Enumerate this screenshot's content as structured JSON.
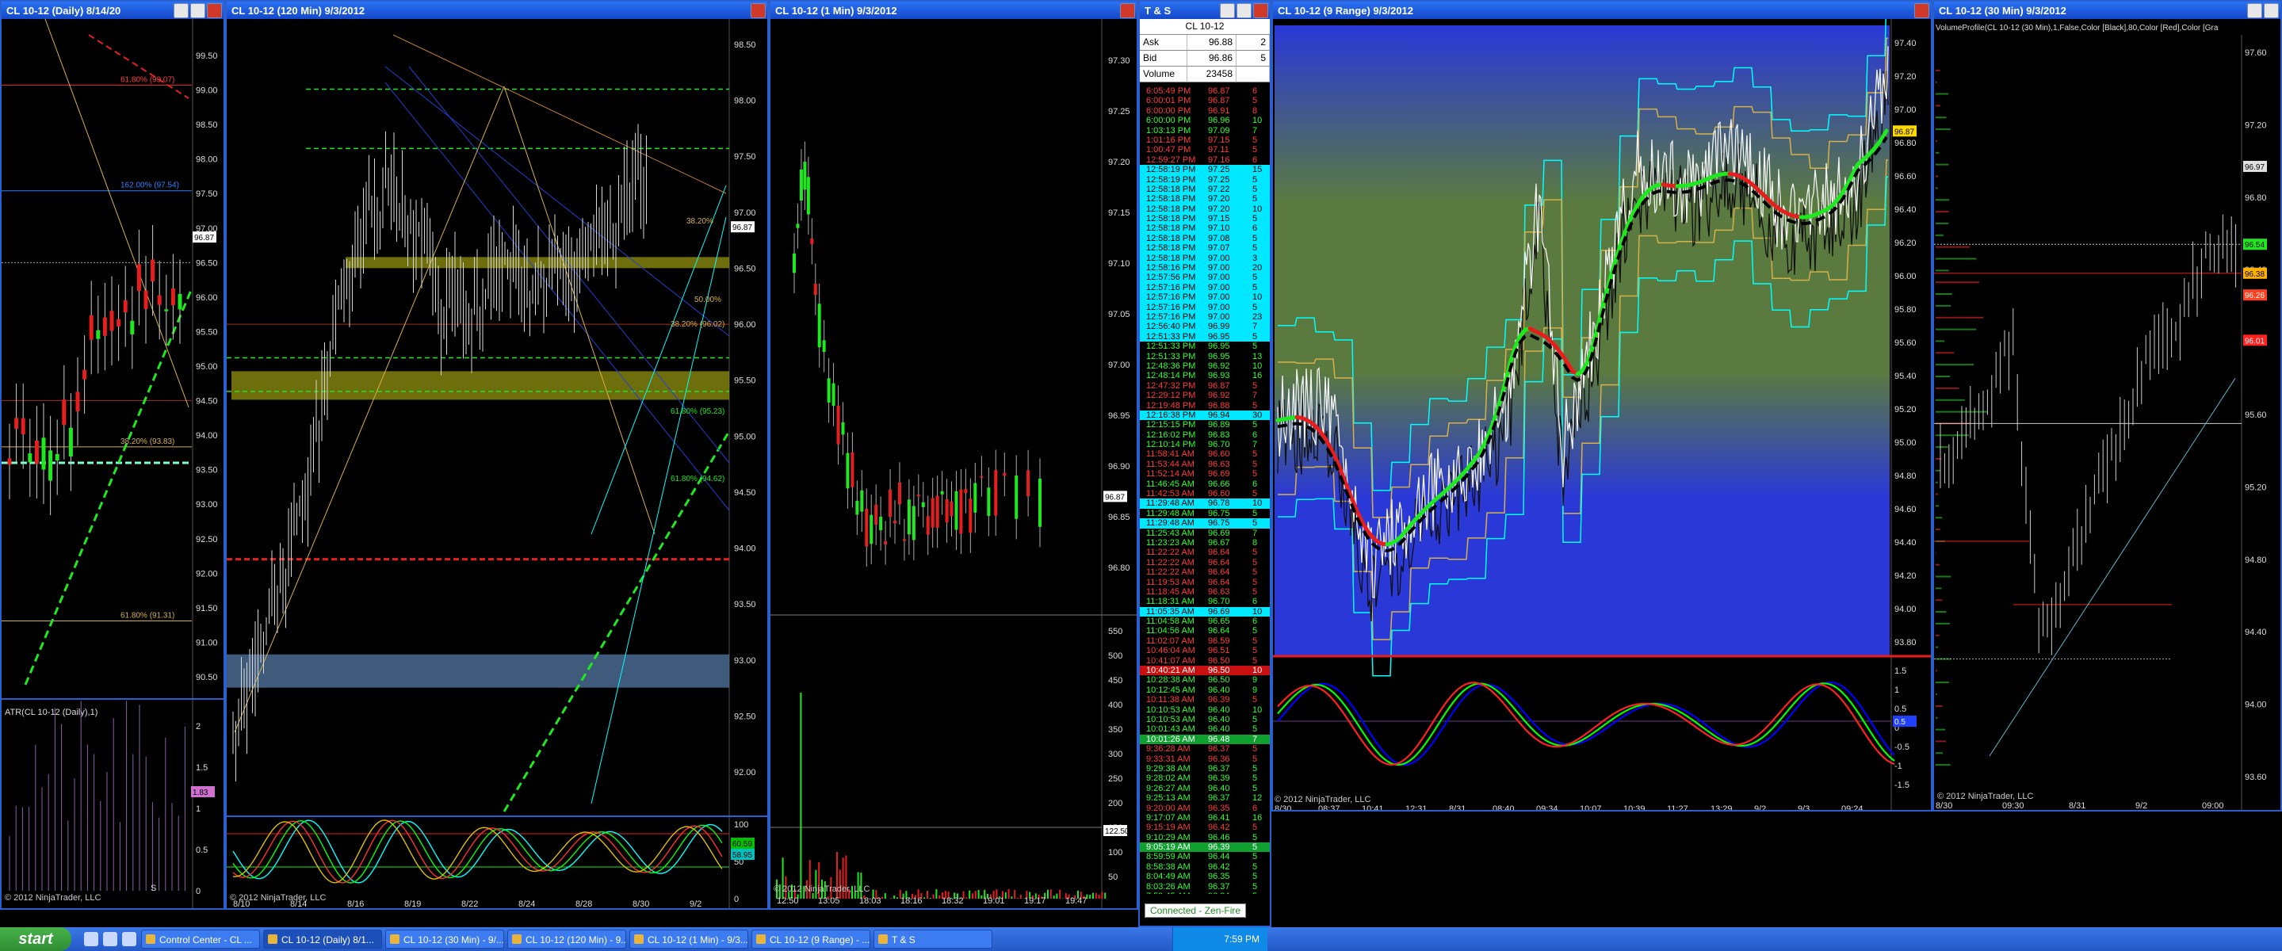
{
  "windows": {
    "daily": {
      "title": "CL 10-12 (Daily)  8/14/20",
      "price_tag": "96.87",
      "axis": [
        "99.50",
        "99.00",
        "98.50",
        "98.00",
        "97.50",
        "97.00",
        "96.50",
        "96.00",
        "95.50",
        "95.00",
        "94.50",
        "94.00",
        "93.50",
        "93.00",
        "92.50",
        "92.00",
        "91.50",
        "91.00",
        "90.50"
      ],
      "fib_labels": [
        "61.80% (99.07)",
        "162.00% (97.54)",
        "38.20% (93.83)",
        "61.80% (91.31)"
      ],
      "indicator_label": "ATR(CL 10-12 (Daily),1)",
      "ind_axis": [
        "2",
        "1.5",
        "1",
        "0.5",
        "0"
      ],
      "ind_tag": "1.83",
      "xaxis": [
        "S"
      ],
      "copyright": "© 2012 NinjaTrader, LLC"
    },
    "min120": {
      "title": "CL 10-12 (120 Min)  9/3/2012",
      "price_tag": "96.87",
      "axis": [
        "98.50",
        "98.00",
        "97.50",
        "97.00",
        "96.50",
        "96.00",
        "95.50",
        "95.00",
        "94.50",
        "94.00",
        "93.50",
        "93.00",
        "92.50",
        "92.00"
      ],
      "fib_labels": [
        "38.20%",
        "50.00%",
        "38.20% (96.02)",
        "61.80% (95.23)",
        "61.80% (94.62)"
      ],
      "xaxis": [
        "8/10",
        "8/14",
        "8/16",
        "8/19",
        "8/22",
        "8/24",
        "8/28",
        "8/30",
        "9/2"
      ],
      "ind_axis": [
        "100",
        "50",
        "0"
      ],
      "ind_tags": [
        "60.59",
        "58.95"
      ],
      "copyright": "© 2012 NinjaTrader, LLC"
    },
    "min1": {
      "title": "CL 10-12 (1 Min)  9/3/2012",
      "price_tag": "96.87",
      "axis": [
        "97.30",
        "97.25",
        "97.20",
        "97.15",
        "97.10",
        "97.05",
        "97.00",
        "96.95",
        "96.90",
        "96.85",
        "96.80"
      ],
      "vol_axis": [
        "550",
        "500",
        "450",
        "400",
        "350",
        "300",
        "250",
        "200",
        "150",
        "100",
        "50"
      ],
      "vol_tag": "122.50",
      "xaxis": [
        "12:50",
        "13:05",
        "18:03",
        "18:16",
        "18:32",
        "19:01",
        "19:17",
        "19:47"
      ],
      "copyright": "© 2012 NinjaTrader, LLC"
    },
    "ts": {
      "title": "T & S",
      "instrument": "CL 10-12",
      "ask_label": "Ask",
      "ask": "96.88",
      "ask_size": "2",
      "bid_label": "Bid",
      "bid": "96.86",
      "bid_size": "5",
      "volume_label": "Volume",
      "volume": "23458",
      "status": "Connected - Zen-Fire"
    },
    "range": {
      "title": "CL 10-12 (9 Range)  9/3/2012",
      "price_tag": "96.87",
      "axis": [
        "97.40",
        "97.20",
        "97.00",
        "96.80",
        "96.60",
        "96.40",
        "96.20",
        "96.00",
        "95.80",
        "95.60",
        "95.40",
        "95.20",
        "95.00",
        "94.80",
        "94.60",
        "94.40",
        "94.20",
        "94.00",
        "93.80"
      ],
      "ind_axis": [
        "1.5",
        "1",
        "0.5",
        "0",
        "-0.5",
        "-1",
        "-1.5"
      ],
      "ind_tag": "0.5",
      "xaxis": [
        "8/30",
        "08:37",
        "10:41",
        "12:31",
        "8/31",
        "08:40",
        "09:34",
        "10:07",
        "10:39",
        "11:27",
        "13:29",
        "9/2",
        "9/3",
        "09:24"
      ],
      "copyright": "© 2012 NinjaTrader, LLC"
    },
    "min30": {
      "title": "CL 10-12 (30 Min)  9/3/2012",
      "vp_label": "VolumeProfile(CL 10-12 (30 Min),1,False,Color [Black],80,Color [Red],Color [Gra",
      "axis": [
        "97.60",
        "97.20",
        "96.80",
        "96.40",
        "96.00",
        "95.60",
        "95.20",
        "94.80",
        "94.40",
        "94.00",
        "93.60"
      ],
      "tags": [
        "96.97",
        "96.54",
        "96.38",
        "96.26",
        "96.01"
      ],
      "xaxis": [
        "8/30",
        "09:30",
        "8/31",
        "9/2",
        "09:00"
      ],
      "copyright": "© 2012 NinjaTrader, LLC"
    }
  },
  "ts_rows": [
    {
      "t": "6:05:49 PM",
      "p": "96.87",
      "s": "6",
      "c": "r"
    },
    {
      "t": "6:00:01 PM",
      "p": "96.87",
      "s": "5",
      "c": "r"
    },
    {
      "t": "6:00:00 PM",
      "p": "96.91",
      "s": "8",
      "c": "r"
    },
    {
      "t": "6:00:00 PM",
      "p": "96.96",
      "s": "10",
      "c": "g"
    },
    {
      "t": "1:03:13 PM",
      "p": "97.09",
      "s": "7",
      "c": "g"
    },
    {
      "t": "1:01:16 PM",
      "p": "97.15",
      "s": "5",
      "c": "r"
    },
    {
      "t": "1:00:47 PM",
      "p": "97.11",
      "s": "5",
      "c": "r"
    },
    {
      "t": "12:59:27 PM",
      "p": "97.16",
      "s": "6",
      "c": "r"
    },
    {
      "t": "12:58:19 PM",
      "p": "97.25",
      "s": "15",
      "c": "c"
    },
    {
      "t": "12:58:19 PM",
      "p": "97.25",
      "s": "5",
      "c": "c"
    },
    {
      "t": "12:58:18 PM",
      "p": "97.22",
      "s": "5",
      "c": "c"
    },
    {
      "t": "12:58:18 PM",
      "p": "97.20",
      "s": "5",
      "c": "c"
    },
    {
      "t": "12:58:18 PM",
      "p": "97.20",
      "s": "10",
      "c": "c"
    },
    {
      "t": "12:58:18 PM",
      "p": "97.15",
      "s": "5",
      "c": "c"
    },
    {
      "t": "12:58:18 PM",
      "p": "97.10",
      "s": "6",
      "c": "c"
    },
    {
      "t": "12:58:18 PM",
      "p": "97.08",
      "s": "5",
      "c": "c"
    },
    {
      "t": "12:58:18 PM",
      "p": "97.07",
      "s": "5",
      "c": "c"
    },
    {
      "t": "12:58:18 PM",
      "p": "97.00",
      "s": "3",
      "c": "c"
    },
    {
      "t": "12:58:16 PM",
      "p": "97.00",
      "s": "20",
      "c": "c"
    },
    {
      "t": "12:57:56 PM",
      "p": "97.00",
      "s": "5",
      "c": "c"
    },
    {
      "t": "12:57:16 PM",
      "p": "97.00",
      "s": "5",
      "c": "c"
    },
    {
      "t": "12:57:16 PM",
      "p": "97.00",
      "s": "10",
      "c": "c"
    },
    {
      "t": "12:57:16 PM",
      "p": "97.00",
      "s": "5",
      "c": "c"
    },
    {
      "t": "12:57:16 PM",
      "p": "97.00",
      "s": "23",
      "c": "c"
    },
    {
      "t": "12:56:40 PM",
      "p": "96.99",
      "s": "7",
      "c": "c"
    },
    {
      "t": "12:51:33 PM",
      "p": "96.95",
      "s": "5",
      "c": "c"
    },
    {
      "t": "12:51:33 PM",
      "p": "96.95",
      "s": "5",
      "c": "g"
    },
    {
      "t": "12:51:33 PM",
      "p": "96.95",
      "s": "13",
      "c": "g"
    },
    {
      "t": "12:48:36 PM",
      "p": "96.92",
      "s": "10",
      "c": "g"
    },
    {
      "t": "12:48:14 PM",
      "p": "96.93",
      "s": "16",
      "c": "g"
    },
    {
      "t": "12:47:32 PM",
      "p": "96.87",
      "s": "5",
      "c": "r"
    },
    {
      "t": "12:29:12 PM",
      "p": "96.92",
      "s": "7",
      "c": "r"
    },
    {
      "t": "12:19:48 PM",
      "p": "96.88",
      "s": "5",
      "c": "r"
    },
    {
      "t": "12:16:38 PM",
      "p": "96.94",
      "s": "30",
      "c": "c"
    },
    {
      "t": "12:15:15 PM",
      "p": "96.89",
      "s": "5",
      "c": "g"
    },
    {
      "t": "12:16:02 PM",
      "p": "96.83",
      "s": "6",
      "c": "g"
    },
    {
      "t": "12:10:14 PM",
      "p": "96.70",
      "s": "7",
      "c": "g"
    },
    {
      "t": "11:58:41 AM",
      "p": "96.60",
      "s": "5",
      "c": "r"
    },
    {
      "t": "11:53:44 AM",
      "p": "96.63",
      "s": "5",
      "c": "r"
    },
    {
      "t": "11:52:14 AM",
      "p": "96.69",
      "s": "5",
      "c": "r"
    },
    {
      "t": "11:46:45 AM",
      "p": "96.66",
      "s": "6",
      "c": "g"
    },
    {
      "t": "11:42:53 AM",
      "p": "96.60",
      "s": "5",
      "c": "r"
    },
    {
      "t": "11:29:48 AM",
      "p": "96.78",
      "s": "10",
      "c": "c"
    },
    {
      "t": "11:29:48 AM",
      "p": "96.75",
      "s": "5",
      "c": "g"
    },
    {
      "t": "11:29:48 AM",
      "p": "96.75",
      "s": "5",
      "c": "c"
    },
    {
      "t": "11:25:43 AM",
      "p": "96.69",
      "s": "7",
      "c": "g"
    },
    {
      "t": "11:23:23 AM",
      "p": "96.67",
      "s": "8",
      "c": "g"
    },
    {
      "t": "11:22:22 AM",
      "p": "96.64",
      "s": "5",
      "c": "r"
    },
    {
      "t": "11:22:22 AM",
      "p": "96.64",
      "s": "5",
      "c": "r"
    },
    {
      "t": "11:22:22 AM",
      "p": "96.64",
      "s": "5",
      "c": "r"
    },
    {
      "t": "11:19:53 AM",
      "p": "96.64",
      "s": "5",
      "c": "r"
    },
    {
      "t": "11:18:45 AM",
      "p": "96.63",
      "s": "5",
      "c": "r"
    },
    {
      "t": "11:18:31 AM",
      "p": "96.70",
      "s": "6",
      "c": "g"
    },
    {
      "t": "11:05:35 AM",
      "p": "96.69",
      "s": "10",
      "c": "c"
    },
    {
      "t": "11:04:58 AM",
      "p": "96.65",
      "s": "6",
      "c": "g"
    },
    {
      "t": "11:04:56 AM",
      "p": "96.64",
      "s": "5",
      "c": "g"
    },
    {
      "t": "11:02:07 AM",
      "p": "96.59",
      "s": "5",
      "c": "r"
    },
    {
      "t": "10:46:04 AM",
      "p": "96.51",
      "s": "5",
      "c": "r"
    },
    {
      "t": "10:41:07 AM",
      "p": "96.50",
      "s": "5",
      "c": "r"
    },
    {
      "t": "10:40:21 AM",
      "p": "96.50",
      "s": "10",
      "c": "rb"
    },
    {
      "t": "10:28:38 AM",
      "p": "96.50",
      "s": "9",
      "c": "g"
    },
    {
      "t": "10:12:45 AM",
      "p": "96.40",
      "s": "9",
      "c": "g"
    },
    {
      "t": "10:11:38 AM",
      "p": "96.39",
      "s": "5",
      "c": "r"
    },
    {
      "t": "10:10:53 AM",
      "p": "96.40",
      "s": "10",
      "c": "g"
    },
    {
      "t": "10:10:53 AM",
      "p": "96.40",
      "s": "5",
      "c": "g"
    },
    {
      "t": "10:01:43 AM",
      "p": "96.40",
      "s": "5",
      "c": "g"
    },
    {
      "t": "10:01:26 AM",
      "p": "96.48",
      "s": "7",
      "c": "gb"
    },
    {
      "t": "9:36:28 AM",
      "p": "96.37",
      "s": "5",
      "c": "r"
    },
    {
      "t": "9:33:31 AM",
      "p": "96.36",
      "s": "5",
      "c": "r"
    },
    {
      "t": "9:29:38 AM",
      "p": "96.37",
      "s": "5",
      "c": "g"
    },
    {
      "t": "9:28:02 AM",
      "p": "96.39",
      "s": "5",
      "c": "g"
    },
    {
      "t": "9:26:27 AM",
      "p": "96.40",
      "s": "5",
      "c": "g"
    },
    {
      "t": "9:25:13 AM",
      "p": "96.37",
      "s": "12",
      "c": "g"
    },
    {
      "t": "9:20:00 AM",
      "p": "96.35",
      "s": "6",
      "c": "r"
    },
    {
      "t": "9:17:07 AM",
      "p": "96.41",
      "s": "16",
      "c": "g"
    },
    {
      "t": "9:15:19 AM",
      "p": "96.42",
      "s": "5",
      "c": "r"
    },
    {
      "t": "9:10:29 AM",
      "p": "96.46",
      "s": "5",
      "c": "g"
    },
    {
      "t": "9:05:19 AM",
      "p": "96.39",
      "s": "5",
      "c": "gb"
    },
    {
      "t": "8:59:59 AM",
      "p": "96.44",
      "s": "5",
      "c": "g"
    },
    {
      "t": "8:58:38 AM",
      "p": "96.42",
      "s": "5",
      "c": "g"
    },
    {
      "t": "8:04:49 AM",
      "p": "96.35",
      "s": "5",
      "c": "g"
    },
    {
      "t": "8:03:26 AM",
      "p": "96.37",
      "s": "5",
      "c": "g"
    },
    {
      "t": "7:59:45 AM",
      "p": "96.34",
      "s": "5",
      "c": "g"
    }
  ],
  "taskbar": {
    "start": "start",
    "tasks": [
      "Control Center - CL ...",
      "CL 10-12 (Daily)  8/1...",
      "CL 10-12 (30 Min) - 9/...",
      "CL 10-12 (120 Min) - 9...",
      "CL 10-12 (1 Min) - 9/3...",
      "CL 10-12 (9 Range) - ...",
      "T & S"
    ],
    "clock": "7:59 PM"
  },
  "colors": {
    "green": "#1ee81e",
    "red": "#e81e1e",
    "cyan": "#00ffff",
    "gold": "#d6b14a",
    "blue": "#2a5fcf"
  }
}
